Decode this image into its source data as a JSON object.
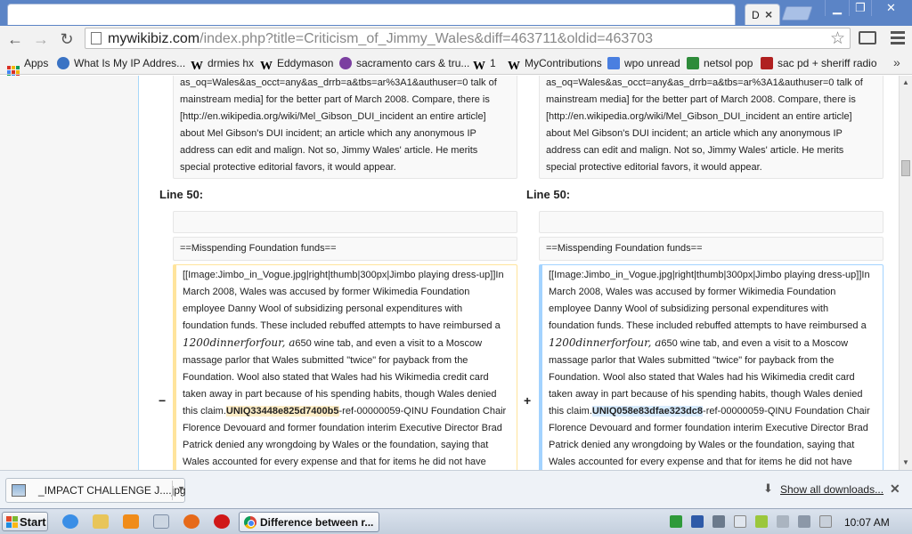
{
  "browser": {
    "tab_title": "D",
    "tab_close": "×",
    "url_host": "mywikibiz.com",
    "url_path": "/index.php?title=Criticism_of_Jimmy_Wales&diff=463711&oldid=463703",
    "star_glyph": "☆",
    "window_buttons": {
      "minimize": "▁",
      "restore": "❐",
      "close": "✕"
    }
  },
  "nav": {
    "back": "←",
    "forward": "→",
    "reload": "↻"
  },
  "bookmarks": [
    {
      "label": "Apps",
      "icon": "apps-grid-icon"
    },
    {
      "label": "What Is My IP Addres...",
      "icon": "globe-icon",
      "color": "#3a73c4"
    },
    {
      "label": "drmies hx",
      "icon": "wikipedia-icon"
    },
    {
      "label": "Eddymason",
      "icon": "wikipedia-icon"
    },
    {
      "label": "sacramento cars & tru...",
      "icon": "peace-icon",
      "color": "#7b3fa0"
    },
    {
      "label": "1",
      "icon": "wikipedia-icon"
    },
    {
      "label": "MyContributions",
      "icon": "wikipedia-icon"
    },
    {
      "label": "wpo unread",
      "icon": "google-icon",
      "color": "#4a7fe0"
    },
    {
      "label": "netsol pop",
      "icon": "ns-icon",
      "color": "#2e8b3a"
    },
    {
      "label": "sac pd + sheriff radio",
      "icon": "radio-icon",
      "color": "#b02020"
    }
  ],
  "bookmarks_more": "»",
  "diff": {
    "top_text": "as_oq=Wales&as_occt=any&as_drrb=a&tbs=ar%3A1&authuser=0 talk of mainstream media] for the better part of March 2008.  Compare, there is [http://en.wikipedia.org/wiki/Mel_Gibson_DUI_incident an entire article] about Mel Gibson's DUI incident; an article which any anonymous IP address can edit and malign.  Not so, Jimmy Wales' article.  He merits special protective editorial favors, it would appear.",
    "line_label_left": "Line 50:",
    "line_label_right": "Line 50:",
    "heading": "==Misspending Foundation funds==",
    "para_start": "[[Image:Jimbo_in_Vogue.jpg|right|thumb|300px|Jimbo playing dress-up]]In March 2008, Wales was accused by former Wikimedia Foundation employee Danny Wool of subsidizing personal expenditures with foundation funds.  These included rebuffed attempts to have reimbursed a ",
    "para_math": "1200dinnerforfour, a",
    "para_mid": "650 wine tab, and even a visit to a Moscow massage parlor that Wales submitted \"twice\" for payback from the Foundation. Wool also stated that Wales had his Wikimedia credit card taken away in part because of his spending habits, though Wales denied this claim.",
    "uniq_left": "UNIQ33448e825d7400b5",
    "uniq_right": "UNIQ058e83dfae323dc8",
    "para_end": "-ref-00000059-QINU Foundation Chair Florence Devouard and former foundation interim Executive Director Brad Patrick denied any wrongdoing by Wales or the foundation, saying that Wales accounted for every expense and that for items he did not have",
    "marker_minus": "−",
    "marker_plus": "+"
  },
  "downloads": {
    "file_name": "_IMPACT CHALLENGE J....jpg",
    "show_all": "Show all downloads...",
    "close": "✕"
  },
  "taskbar": {
    "start_label": "Start",
    "task_label": "Difference between r...",
    "clock": "10:07 AM"
  }
}
